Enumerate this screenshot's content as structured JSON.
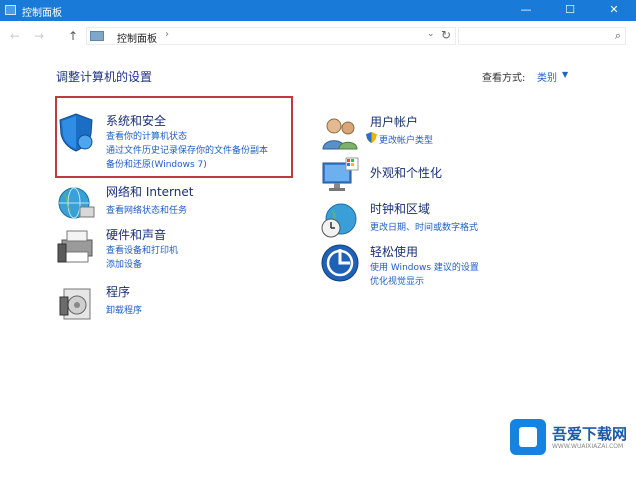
{
  "window": {
    "title": "控制面板",
    "minimize": "—",
    "maximize": "☐",
    "close": "✕"
  },
  "address": {
    "back": "←",
    "forward": "→",
    "up": "↑",
    "crumb": "控制面板",
    "crumb_sep": "›",
    "dropdown": "⌄",
    "refresh": "↻",
    "search_icon": "⌕"
  },
  "main": {
    "heading": "调整计算机的设置",
    "view_by_label": "查看方式:",
    "view_by_value": "类别",
    "view_by_arrow": "▼"
  },
  "categories": [
    {
      "title": "系统和安全",
      "icon": "shield-icon",
      "links": [
        "查看你的计算机状态",
        "通过文件历史记录保存你的文件备份副本",
        "备份和还原(Windows 7)"
      ]
    },
    {
      "title": "网络和 Internet",
      "icon": "network-globe-icon",
      "links": [
        "查看网络状态和任务"
      ]
    },
    {
      "title": "硬件和声音",
      "icon": "printer-icon",
      "links": [
        "查看设备和打印机",
        "添加设备"
      ]
    },
    {
      "title": "程序",
      "icon": "program-disk-icon",
      "links": [
        "卸载程序"
      ]
    },
    {
      "title": "用户帐户",
      "icon": "users-icon",
      "links": [
        "更改帐户类型"
      ]
    },
    {
      "title": "外观和个性化",
      "icon": "monitor-icon",
      "links": []
    },
    {
      "title": "时钟和区域",
      "icon": "clock-globe-icon",
      "links": [
        "更改日期、时间或数字格式"
      ]
    },
    {
      "title": "轻松使用",
      "icon": "ease-of-access-icon",
      "links": [
        "使用 Windows 建议的设置",
        "优化视觉显示"
      ]
    }
  ],
  "watermark": {
    "brand": "吾爱下载网",
    "url": "WWW.WUAIXIAZAI.COM"
  },
  "colors": {
    "titlebar": "#1a7ad8",
    "heading": "#1e3287",
    "link": "#1e5ec8",
    "highlight": "#c0393f"
  }
}
